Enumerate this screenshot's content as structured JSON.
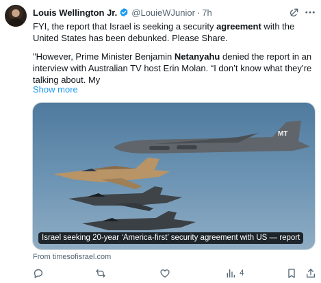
{
  "author": {
    "name": "Louis Wellington Jr.",
    "handle": "@LouieWJunior",
    "separator": "·",
    "time": "7h"
  },
  "tweet": {
    "p1_before": "FYI, the report that Israel is seeking a security ",
    "p1_bold": "agreement",
    "p1_after": " with the United States has been debunked. Please Share.",
    "p2_before": "\"However, Prime Minister Benjamin ",
    "p2_bold": "Netanyahu",
    "p2_after": " denied the report in an interview with Australian TV host Erin Molan. “I don’t know what they’re talking about. My",
    "show_more": "Show more"
  },
  "card": {
    "caption": "Israel seeking 20-year ‘America-first’ security agreement with US — report",
    "source": "From timesofisrael.com",
    "tail_code": "MT"
  },
  "actions": {
    "reply_count": "",
    "retweet_count": "",
    "like_count": "",
    "views_count": "4"
  },
  "colors": {
    "accent": "#1d9bf0",
    "secondary_text": "#536471",
    "verified": "#1d9bf0"
  },
  "icons": [
    "verified-badge-icon",
    "grok-icon",
    "more-icon",
    "reply-icon",
    "retweet-icon",
    "like-icon",
    "views-icon",
    "bookmark-icon",
    "share-icon"
  ]
}
